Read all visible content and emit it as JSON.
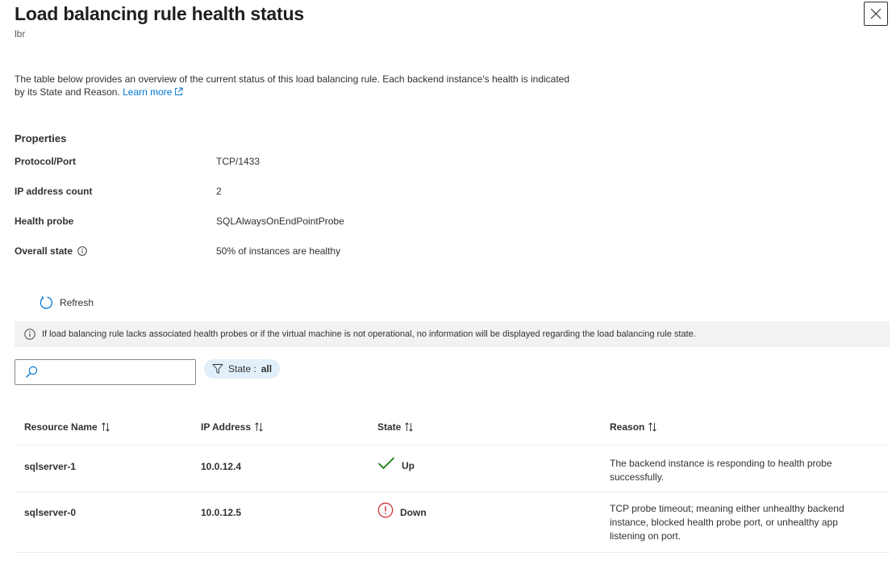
{
  "panel": {
    "title": "Load balancing rule health status",
    "subtitle": "lbr",
    "description": "The table below provides an overview of the current status of this load balancing rule. Each backend instance's health is indicated by its State and Reason.",
    "learn_more": "Learn more"
  },
  "properties": {
    "heading": "Properties",
    "items": [
      {
        "label": "Protocol/Port",
        "value": "TCP/1433"
      },
      {
        "label": "IP address count",
        "value": "2"
      },
      {
        "label": "Health probe",
        "value": "SQLAlwaysOnEndPointProbe"
      },
      {
        "label": "Overall state",
        "value": "50% of instances are healthy"
      }
    ]
  },
  "toolbar": {
    "refresh_label": "Refresh"
  },
  "info_bar": {
    "text": "If load balancing rule lacks associated health probes or if the virtual machine is not operational, no information will be displayed regarding the load balancing rule state."
  },
  "filter": {
    "search_value": "",
    "search_placeholder": "",
    "pill_prefix": "State : ",
    "pill_value": "all"
  },
  "table": {
    "headers": [
      "Resource Name",
      "IP Address",
      "State",
      "Reason"
    ],
    "rows": [
      {
        "name": "sqlserver-1",
        "ip": "10.0.12.4",
        "state": "Up",
        "state_icon": "checkmark-icon",
        "reason": "The backend instance is responding to health probe successfully."
      },
      {
        "name": "sqlserver-0",
        "ip": "10.0.12.5",
        "state": "Down",
        "state_icon": "error-icon",
        "reason": "TCP probe timeout; meaning either unhealthy backend instance, blocked health probe port, or unhealthy app listening on port."
      }
    ]
  },
  "colors": {
    "link": "#0078d4",
    "success": "#107c10",
    "error": "#d13438",
    "filter_pill_bg": "#e1effa",
    "info_bar_bg": "#f3f2f1"
  }
}
